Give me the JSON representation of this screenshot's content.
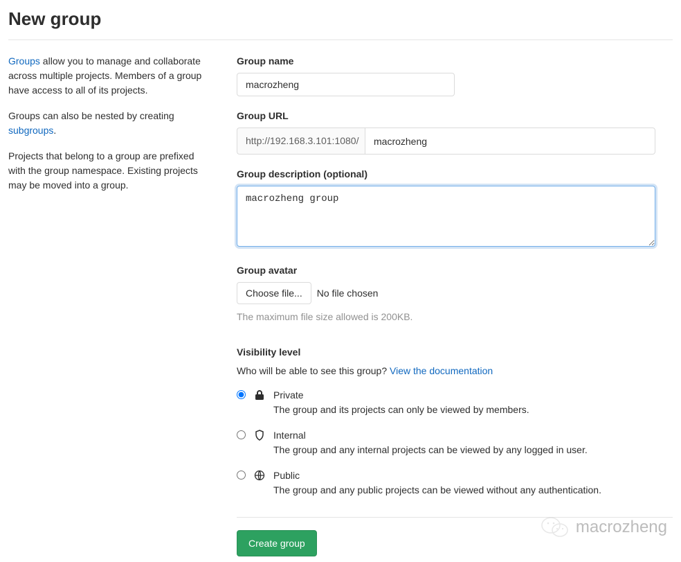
{
  "page": {
    "title": "New group"
  },
  "sidebar": {
    "p1_link": "Groups",
    "p1_rest": " allow you to manage and collaborate across multiple projects. Members of a group have access to all of its projects.",
    "p2_pre": "Groups can also be nested by creating ",
    "p2_link": "subgroups",
    "p2_post": ".",
    "p3": "Projects that belong to a group are prefixed with the group namespace. Existing projects may be moved into a group."
  },
  "form": {
    "name_label": "Group name",
    "name_value": "macrozheng",
    "url_label": "Group URL",
    "url_prefix": "http://192.168.3.101:1080/",
    "url_value": "macrozheng",
    "desc_label": "Group description (optional)",
    "desc_value": "macrozheng group",
    "avatar_label": "Group avatar",
    "choose_file": "Choose file...",
    "no_file": "No file chosen",
    "file_hint": "The maximum file size allowed is 200KB."
  },
  "visibility": {
    "label": "Visibility level",
    "help_pre": "Who will be able to see this group? ",
    "help_link": "View the documentation",
    "options": [
      {
        "title": "Private",
        "desc": "The group and its projects can only be viewed by members.",
        "checked": true
      },
      {
        "title": "Internal",
        "desc": "The group and any internal projects can be viewed by any logged in user.",
        "checked": false
      },
      {
        "title": "Public",
        "desc": "The group and any public projects can be viewed without any authentication.",
        "checked": false
      }
    ]
  },
  "footer": {
    "submit": "Create group"
  },
  "watermark": {
    "text": "macrozheng"
  }
}
